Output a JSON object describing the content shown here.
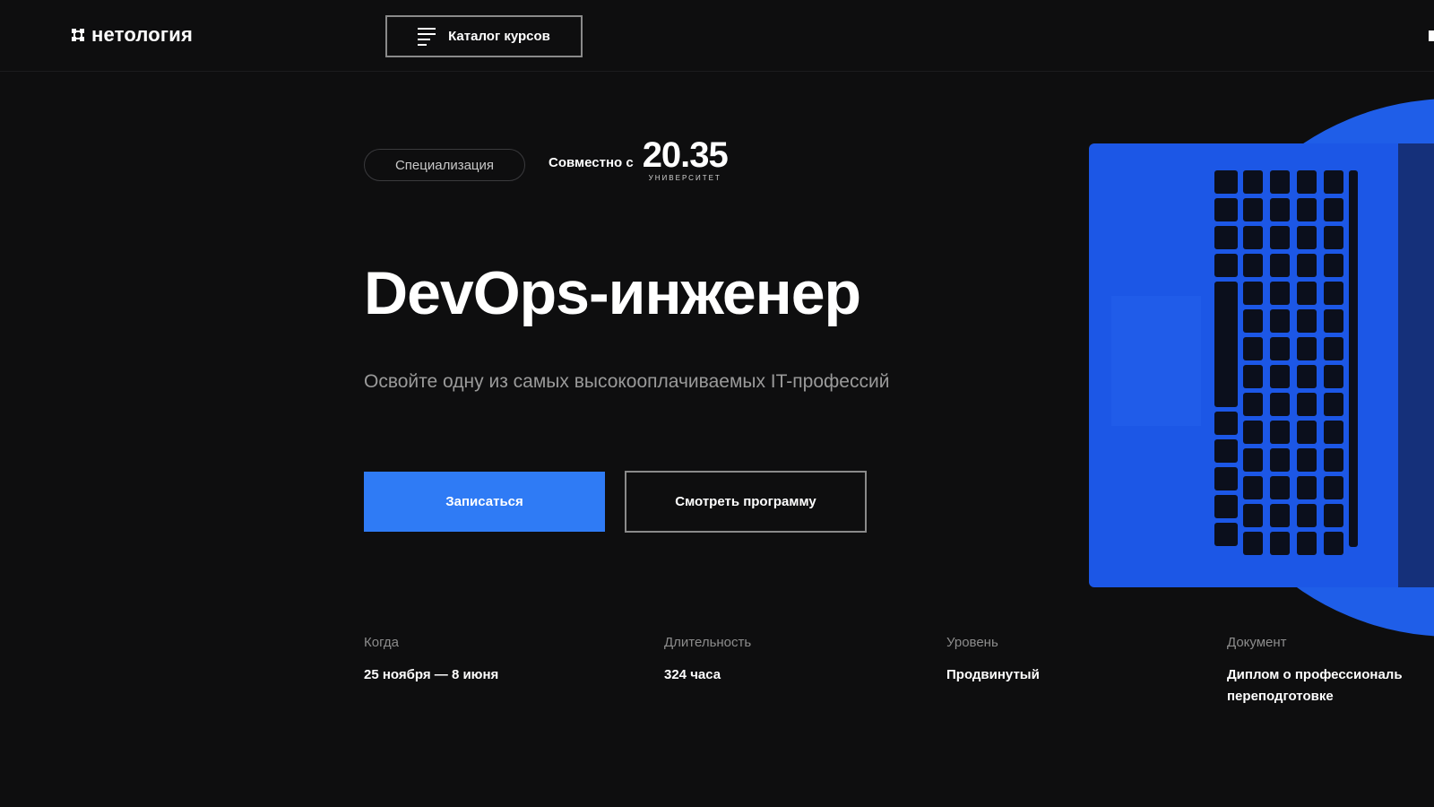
{
  "header": {
    "logo_text": "нетология",
    "catalog_button_label": "Каталог курсов"
  },
  "hero": {
    "tag": "Специализация",
    "partner_prefix": "Совместно с",
    "partner_logo_number": "20.35",
    "partner_logo_subtitle": "УНИВЕРСИТЕТ",
    "title": "DevOps-инженер",
    "subtitle": "Освойте одну из самых высокооплачиваемых IT-профессий",
    "primary_button": "Записаться",
    "secondary_button": "Смотреть программу"
  },
  "facts": [
    {
      "label": "Когда",
      "value": "25 ноября — 8 июня"
    },
    {
      "label": "Длительность",
      "value": "324 часа"
    },
    {
      "label": "Уровень",
      "value": "Продвинутый"
    },
    {
      "label": "Документ",
      "value": "Диплом о профессиональ переподготовке"
    }
  ],
  "colors": {
    "background": "#0e0e0f",
    "accent": "#2f7bf5",
    "laptop_blue": "#1f5ee8"
  },
  "icons": {
    "logo": "netology-logo-icon",
    "catalog": "menu-lines-icon"
  }
}
